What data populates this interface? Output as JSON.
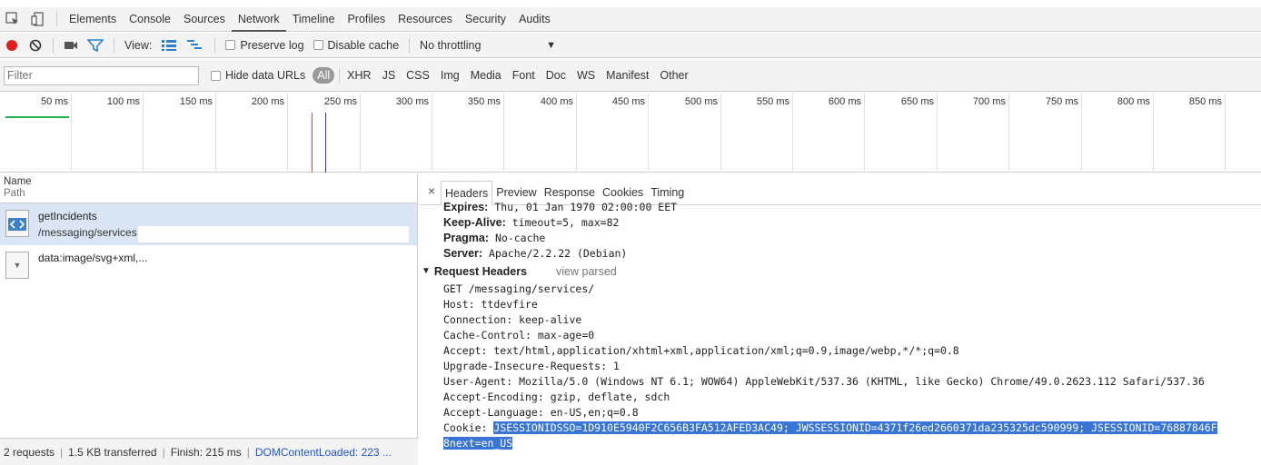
{
  "main_tabs": [
    "Elements",
    "Console",
    "Sources",
    "Network",
    "Timeline",
    "Profiles",
    "Resources",
    "Security",
    "Audits"
  ],
  "selected_main_tab": "Network",
  "toolbar": {
    "view_label": "View:",
    "preserve_log": "Preserve log",
    "disable_cache": "Disable cache",
    "throttling": "No throttling"
  },
  "filter": {
    "placeholder": "Filter",
    "hide_data_urls": "Hide data URLs",
    "types": [
      "All",
      "XHR",
      "JS",
      "CSS",
      "Img",
      "Media",
      "Font",
      "Doc",
      "WS",
      "Manifest",
      "Other"
    ]
  },
  "timeline_ticks": [
    "50 ms",
    "100 ms",
    "150 ms",
    "200 ms",
    "250 ms",
    "300 ms",
    "350 ms",
    "400 ms",
    "450 ms",
    "500 ms",
    "550 ms",
    "600 ms",
    "650 ms",
    "700 ms",
    "750 ms",
    "800 ms",
    "850 ms"
  ],
  "request_list": {
    "col_name": "Name",
    "col_path": "Path",
    "requests": [
      {
        "name": "getIncidents",
        "path": "/messaging/services,"
      },
      {
        "name": "data:image/svg+xml,...",
        "path": ""
      }
    ],
    "status": {
      "requests": "2 requests",
      "transferred": "1.5 KB transferred",
      "finish": "Finish: 215 ms",
      "dcl": "DOMContentLoaded: 223 ..."
    }
  },
  "detail_tabs": [
    "Headers",
    "Preview",
    "Response",
    "Cookies",
    "Timing"
  ],
  "selected_detail_tab": "Headers",
  "response_headers": [
    {
      "key": "Expires:",
      "value": "Thu, 01 Jan 1970 02:00:00 EET"
    },
    {
      "key": "Keep-Alive:",
      "value": "timeout=5, max=82"
    },
    {
      "key": "Pragma:",
      "value": "No-cache"
    },
    {
      "key": "Server:",
      "value": "Apache/2.2.22 (Debian)"
    }
  ],
  "request_headers": {
    "title": "Request Headers",
    "view_parsed": "view parsed",
    "lines": [
      "GET /messaging/services/",
      "Host: ttdevfire",
      "Connection: keep-alive",
      "Cache-Control: max-age=0",
      "Accept: text/html,application/xhtml+xml,application/xml;q=0.9,image/webp,*/*;q=0.8",
      "Upgrade-Insecure-Requests: 1",
      "User-Agent: Mozilla/5.0 (Windows NT 6.1; WOW64) AppleWebKit/537.36 (KHTML, like Gecko) Chrome/49.0.2623.112 Safari/537.36",
      "Accept-Encoding: gzip, deflate, sdch",
      "Accept-Language: en-US,en;q=0.8"
    ],
    "cookie_label": "Cookie: ",
    "cookie_value": "JSESSIONIDSSO=1D910E5940F2C656B3FA512AFED3AC49; JWSSESSIONID=4371f26ed2660371da235325dc590999; JSESSIONID=76887846F",
    "cookie_cont": "8next=en_US"
  },
  "colors": {
    "accent": "#3875d7",
    "record": "#e0201c",
    "filter_icon": "#2d7fd1"
  }
}
